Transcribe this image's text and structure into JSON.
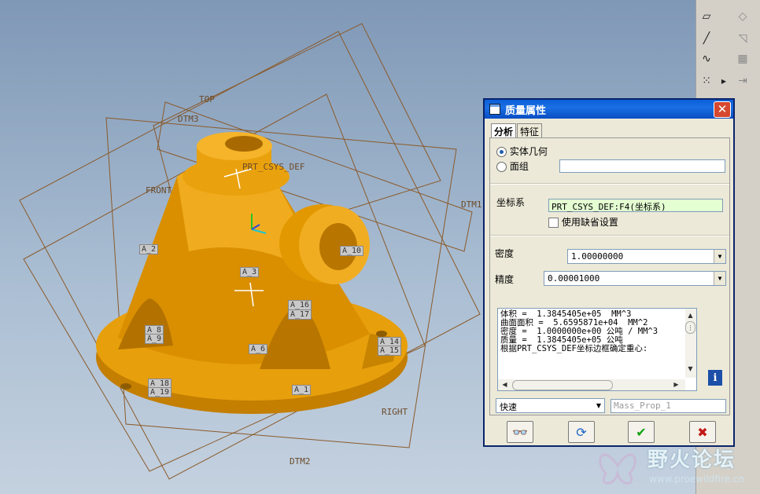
{
  "viewport": {
    "planes": {
      "top": "TOP",
      "front": "FRONT",
      "right": "RIGHT",
      "dtm1": "DTM1",
      "dtm2": "DTM2",
      "dtm3": "DTM3",
      "csys": "PRT_CSYS_DEF"
    },
    "axis_tags": [
      "A_2",
      "A_3",
      "A_10",
      "A_16",
      "A_17",
      "A_8",
      "A_9",
      "A_18",
      "A_19",
      "A_14",
      "A_15",
      "A_6",
      "A_1"
    ],
    "model_color": "#e39a00"
  },
  "dialog": {
    "title": "质量属性",
    "close_glyph": "✕",
    "tabs": [
      "分析",
      "特征"
    ],
    "solid_geometry": "实体几何",
    "quilt": "面组",
    "quilt_value": "",
    "csys_label": "坐标系",
    "csys_value": "PRT_CSYS_DEF:F4(坐标系)",
    "use_default": "使用缺省设置",
    "density_label": "密度",
    "density_value": "1.00000000",
    "accuracy_label": "精度",
    "accuracy_value": "0.00001000",
    "results": [
      "体积 =  1.3845405e+05  MM^3",
      "曲面面积 =  5.6595871e+04  MM^2",
      "密度 =  1.0000000e+00 公吨 / MM^3",
      "质量 =  1.3845405e+05 公吨",
      "",
      "根据PRT_CSYS_DEF坐标边框确定重心:"
    ],
    "mode_value": "快速",
    "name_placeholder": "Mass_Prop_1",
    "accent": "#0a246a"
  },
  "watermark": {
    "brand": "野火论坛",
    "url": "www.proewildfire.cn"
  }
}
